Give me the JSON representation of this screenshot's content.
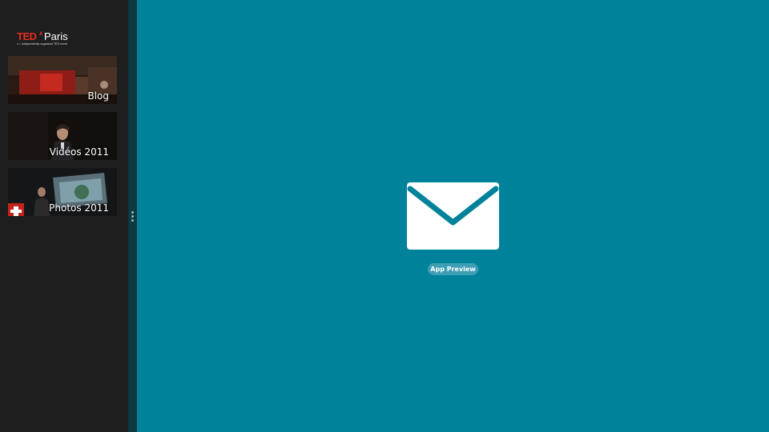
{
  "sidebar": {
    "logo": {
      "ted": "TED",
      "x": "x",
      "city": "Paris",
      "tagline": "x = independently organized TED event"
    },
    "tiles": [
      {
        "label": "Blog"
      },
      {
        "label": "Vidéos 2011"
      },
      {
        "label": "Photos 2011"
      }
    ]
  },
  "main": {
    "icon": "mail-icon",
    "preview_label": "App Preview"
  },
  "colors": {
    "background": "#00829b",
    "sidebar": "#1e1e1e",
    "ted_red": "#e62b1e",
    "pill": "#3c9fb3"
  }
}
